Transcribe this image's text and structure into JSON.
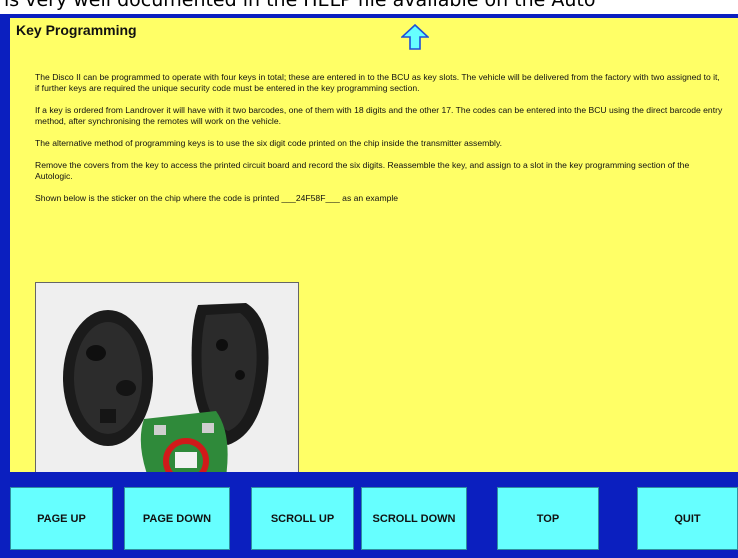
{
  "header_strip": {
    "text": "is very well documented in the HELP file available on the Auto"
  },
  "page": {
    "title": "Key Programming",
    "paragraphs": [
      "The Disco II can be programmed to operate with four keys in total; these are entered in to the BCU as key slots. The vehicle will be delivered from the factory with two assigned to it, if further keys are required the unique security code must be entered in the key programming section.",
      "If a key is ordered from Landrover it will have with it two barcodes, one of them with 18 digits and the other 17. The codes can be entered into the BCU using the direct barcode entry method, after synchronising the remotes will work on the vehicle.",
      "The alternative method of programming keys is to use the six digit code printed on the chip inside the transmitter assembly.",
      "Remove the covers from the key to access the printed circuit board and record the six digits. Reassemble the key, and assign to a slot in the key programming section of the Autologic.",
      "Shown below is the sticker on the chip where the code is printed ___24F58F___ as an example"
    ]
  },
  "toolbar": {
    "page_up": "PAGE UP",
    "page_down": "PAGE DOWN",
    "scroll_up": "SCROLL UP",
    "scroll_down": "SCROLL DOWN",
    "top": "TOP",
    "quit": "QUIT"
  },
  "colors": {
    "frame": "#0b1fbf",
    "content_background": "#ffff66",
    "button_background": "#66ffff"
  }
}
